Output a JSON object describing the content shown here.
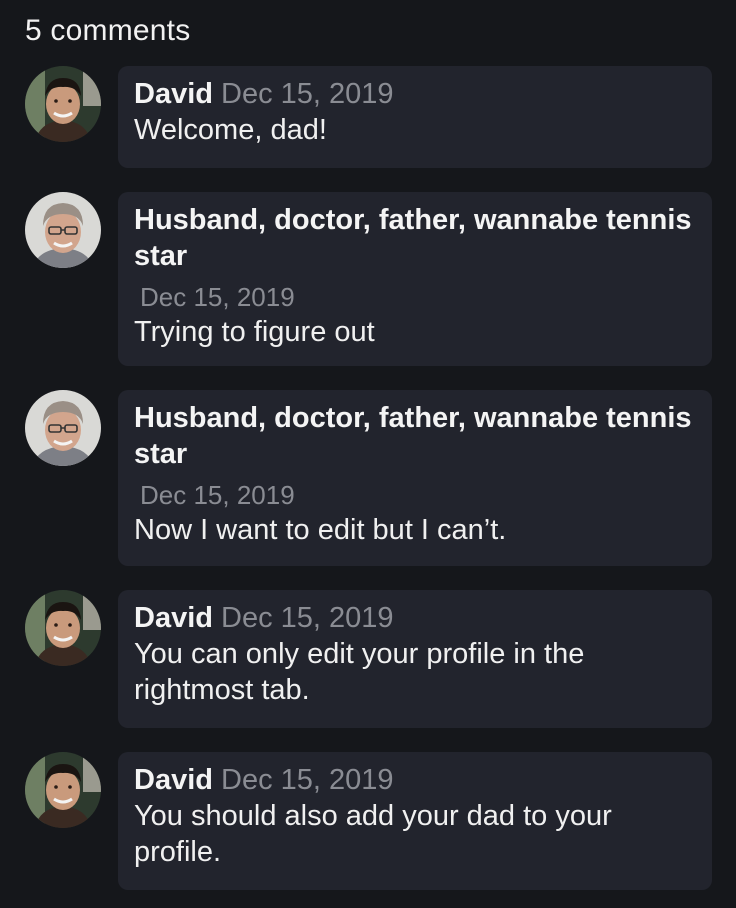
{
  "header": {
    "count_label": "5 comments"
  },
  "comments": [
    {
      "author": "David",
      "date": "Dec 15, 2019",
      "text": "Welcome, dad!",
      "avatar": "david-avatar"
    },
    {
      "author": "Husband, doctor, father, wannabe tennis star",
      "date": "Dec 15, 2019",
      "text": "Trying to figure out",
      "avatar": "dad-avatar"
    },
    {
      "author": "Husband, doctor, father, wannabe tennis star",
      "date": "Dec 15, 2019",
      "text": "Now I want to edit but I can’t.",
      "avatar": "dad-avatar"
    },
    {
      "author": "David",
      "date": "Dec 15, 2019",
      "text": "You can only edit your profile in the rightmost tab.",
      "avatar": "david-avatar"
    },
    {
      "author": "David",
      "date": "Dec 15, 2019",
      "text": "You should also add your dad to your profile.",
      "avatar": "david-avatar"
    }
  ]
}
